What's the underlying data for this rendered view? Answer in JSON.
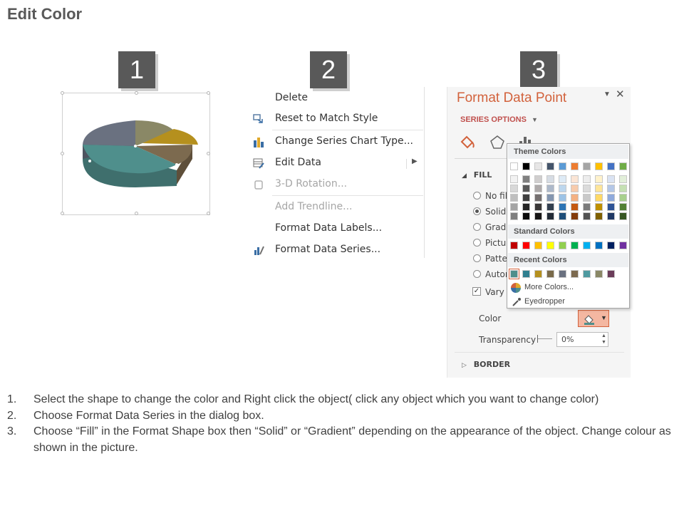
{
  "page": {
    "title": "Edit Color"
  },
  "steps": [
    "1",
    "2",
    "3"
  ],
  "colors": {
    "badge": "#595959",
    "accent": "#d2623c",
    "pie": [
      "#8a8866",
      "#b5901e",
      "#7c6a4f",
      "#4f8f8c",
      "#6a7180"
    ]
  },
  "context_menu": {
    "items": [
      {
        "label": "Delete",
        "icon": "none",
        "disabled": false
      },
      {
        "label": "Reset to Match Style",
        "icon": "reset-style-icon",
        "disabled": false
      },
      {
        "label": "Change Series Chart Type...",
        "icon": "bar-chart-icon",
        "disabled": false
      },
      {
        "label": "Edit Data",
        "icon": "edit-data-icon",
        "disabled": false,
        "submenu": true
      },
      {
        "label": "3-D Rotation...",
        "icon": "rotation-icon",
        "disabled": true
      },
      {
        "label": "Add Trendline...",
        "icon": "none",
        "disabled": true
      },
      {
        "label": "Format Data Labels...",
        "icon": "none",
        "disabled": false
      },
      {
        "label": "Format Data Series...",
        "icon": "format-series-icon",
        "disabled": false
      }
    ]
  },
  "format_pane": {
    "title": "Format Data Point",
    "series_options": "SERIES OPTIONS",
    "fill_header": "FILL",
    "fill_options": [
      {
        "label": "No fill",
        "checked": false
      },
      {
        "label": "Solid f",
        "checked": true
      },
      {
        "label": "Gradie",
        "checked": false
      },
      {
        "label": "Pictur",
        "checked": false
      },
      {
        "label": "Patter",
        "checked": false
      },
      {
        "label": "Autom",
        "checked": false
      }
    ],
    "vary_colors_label": "Vary c",
    "color_label": "Color",
    "transparency_label": "Transparency",
    "transparency_value": "0%",
    "border_header": "BORDER"
  },
  "color_dropdown": {
    "theme_header": "Theme Colors",
    "theme_top": [
      "#ffffff",
      "#000000",
      "#e7e6e6",
      "#44546a",
      "#5b9bd5",
      "#ed7d31",
      "#a5a5a5",
      "#ffc000",
      "#4472c4",
      "#70ad47"
    ],
    "theme_shades": [
      [
        "#f2f2f2",
        "#808080",
        "#d0cece",
        "#d6dce4",
        "#deebf6",
        "#fbe5d5",
        "#ededed",
        "#fff2cc",
        "#dae3f3",
        "#e2efd9"
      ],
      [
        "#d8d8d8",
        "#595959",
        "#aeaaaa",
        "#adb9ca",
        "#bdd7ee",
        "#f7cbac",
        "#dbdbdb",
        "#fee599",
        "#b4c7e7",
        "#c5e0b3"
      ],
      [
        "#bfbfbf",
        "#3f3f3f",
        "#757070",
        "#8496b0",
        "#9dc3e6",
        "#f4b183",
        "#c9c9c9",
        "#ffd966",
        "#8faadc",
        "#a8d08d"
      ],
      [
        "#a5a5a5",
        "#262626",
        "#3a3838",
        "#323f4f",
        "#2e75b5",
        "#c55a11",
        "#7b7b7b",
        "#bf9000",
        "#2f5496",
        "#538135"
      ],
      [
        "#7f7f7f",
        "#0c0c0c",
        "#171616",
        "#222a35",
        "#1f4e79",
        "#833c0b",
        "#525252",
        "#7f6000",
        "#1f3864",
        "#375623"
      ]
    ],
    "standard_header": "Standard Colors",
    "standard": [
      "#c00000",
      "#ff0000",
      "#ffc000",
      "#ffff00",
      "#92d050",
      "#00b050",
      "#00b0f0",
      "#0070c0",
      "#002060",
      "#7030a0"
    ],
    "recent_header": "Recent Colors",
    "recent": [
      "#4f8f8c",
      "#2f7f8f",
      "#b5901e",
      "#7a6a4a",
      "#6a7180",
      "#7c6a4f",
      "#4f9aa0",
      "#8a8866",
      "#6b3d5a"
    ],
    "more_colors": "More Colors...",
    "eyedropper": "Eyedropper"
  },
  "instructions": [
    {
      "num": "1.",
      "text": "Select the shape to change the color and Right click the object( click any object which you want to change color)"
    },
    {
      "num": "2.",
      "text": "Choose Format Data Series in the dialog box."
    },
    {
      "num": "3.",
      "text": "Choose “Fill” in the Format Shape box then “Solid” or “Gradient” depending on the appearance of the object. Change colour as shown in the picture."
    }
  ]
}
